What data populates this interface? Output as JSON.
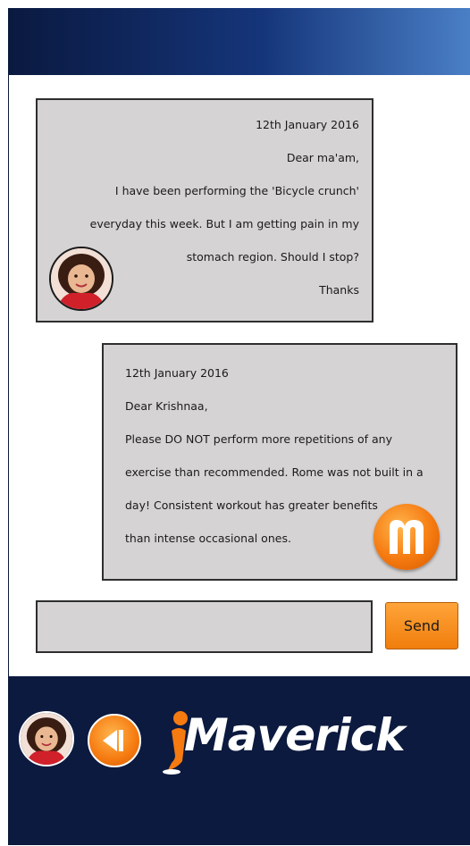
{
  "messages": [
    {
      "direction": "incoming",
      "lines": [
        "12th January 2016",
        "Dear ma'am,",
        "I have been performing the 'Bicycle crunch'",
        "everyday this week. But I am getting pain in my",
        "stomach region. Should I stop?",
        "Thanks"
      ],
      "avatar": "user-avatar-girl"
    },
    {
      "direction": "outgoing",
      "lines": [
        "12th January 2016",
        "Dear Krishnaa,",
        "Please DO NOT perform more repetitions of any",
        "exercise than recommended. Rome was not built in a",
        "day! Consistent workout has greater benefits",
        "than intense occasional ones."
      ],
      "avatar": "maverick-m-badge"
    }
  ],
  "composer": {
    "input_value": "",
    "send_label": "Send"
  },
  "footer": {
    "logo_text": "Maverick"
  },
  "colors": {
    "bubble": "#d6d3d4",
    "accent": "#f57a10",
    "footer": "#0c1a3f",
    "banner_dark": "#0a1940",
    "banner_light": "#4a7fc6"
  }
}
